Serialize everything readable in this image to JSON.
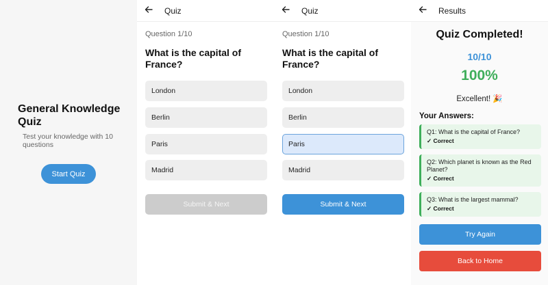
{
  "colors": {
    "primary": "#3d92d8",
    "success": "#3fae5b",
    "danger": "#e74c3c",
    "disabled": "#cccccc"
  },
  "home": {
    "title": "General Knowledge Quiz",
    "subtitle": "Test your knowledge with 10 questions",
    "start_label": "Start Quiz"
  },
  "quiz_unselected": {
    "header": {
      "back_icon": "arrow-left-icon",
      "title": "Quiz"
    },
    "question_number": "Question 1/10",
    "question": "What is the capital of France?",
    "options": [
      "London",
      "Berlin",
      "Paris",
      "Madrid"
    ],
    "submit_label": "Submit & Next"
  },
  "quiz_selected": {
    "header": {
      "back_icon": "arrow-left-icon",
      "title": "Quiz"
    },
    "question_number": "Question 1/10",
    "question": "What is the capital of France?",
    "options": [
      "London",
      "Berlin",
      "Paris",
      "Madrid"
    ],
    "selected_option": "Paris",
    "submit_label": "Submit & Next"
  },
  "results": {
    "header": {
      "back_icon": "arrow-left-icon",
      "title": "Results"
    },
    "heading": "Quiz Completed!",
    "score": "10/10",
    "percent": "100%",
    "message": "Excellent! 🎉",
    "answers_heading": "Your Answers:",
    "answers": [
      {
        "question": "Q1: What is the capital of France?",
        "status": "✓ Correct"
      },
      {
        "question": "Q2: Which planet is known as the Red Planet?",
        "status": "✓ Correct"
      },
      {
        "question": "Q3: What is the largest mammal?",
        "status": "✓ Correct"
      }
    ],
    "try_again_label": "Try Again",
    "back_home_label": "Back to Home"
  }
}
